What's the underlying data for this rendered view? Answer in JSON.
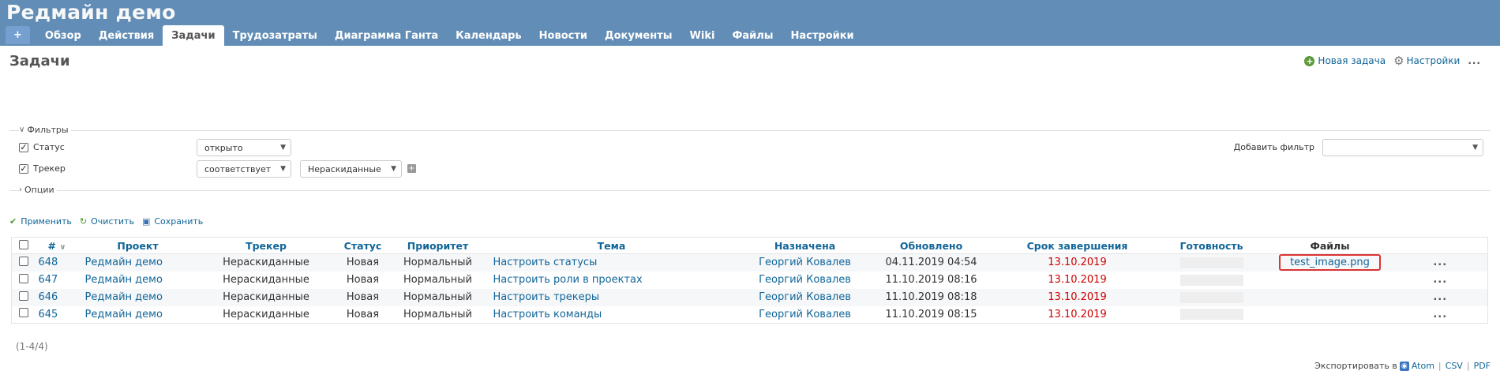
{
  "header": {
    "title": "Редмайн демо",
    "tabs": [
      "+",
      "Обзор",
      "Действия",
      "Задачи",
      "Трудозатраты",
      "Диаграмма Ганта",
      "Календарь",
      "Новости",
      "Документы",
      "Wiki",
      "Файлы",
      "Настройки"
    ],
    "selected_tab": "Задачи"
  },
  "page": {
    "title": "Задачи",
    "new_issue": "Новая задача",
    "settings": "Настройки",
    "more": "..."
  },
  "filters": {
    "legend": "Фильтры",
    "status_label": "Статус",
    "status_value": "открыто",
    "tracker_label": "Трекер",
    "tracker_operator": "соответствует",
    "tracker_value": "Нераскиданные",
    "add_filter_label": "Добавить фильтр",
    "add_filter_value": ""
  },
  "options": {
    "legend": "Опции"
  },
  "actions": {
    "apply": "Применить",
    "clear": "Очистить",
    "save": "Сохранить"
  },
  "table": {
    "columns": [
      "#",
      "Проект",
      "Трекер",
      "Статус",
      "Приоритет",
      "Тема",
      "Назначена",
      "Обновлено",
      "Срок завершения",
      "Готовность",
      "Файлы"
    ],
    "rows": [
      {
        "id": "648",
        "project": "Редмайн демо",
        "tracker": "Нераскиданные",
        "status": "Новая",
        "priority": "Нормальный",
        "subject": "Настроить статусы",
        "assignee": "Георгий Ковалев",
        "updated": "04.11.2019 04:54",
        "due": "13.10.2019",
        "done_pct": 0,
        "files": "test_image.png"
      },
      {
        "id": "647",
        "project": "Редмайн демо",
        "tracker": "Нераскиданные",
        "status": "Новая",
        "priority": "Нормальный",
        "subject": "Настроить роли в проектах",
        "assignee": "Георгий Ковалев",
        "updated": "11.10.2019 08:16",
        "due": "13.10.2019",
        "done_pct": 0,
        "files": ""
      },
      {
        "id": "646",
        "project": "Редмайн демо",
        "tracker": "Нераскиданные",
        "status": "Новая",
        "priority": "Нормальный",
        "subject": "Настроить трекеры",
        "assignee": "Георгий Ковалев",
        "updated": "11.10.2019 08:18",
        "due": "13.10.2019",
        "done_pct": 0,
        "files": ""
      },
      {
        "id": "645",
        "project": "Редмайн демо",
        "tracker": "Нераскиданные",
        "status": "Новая",
        "priority": "Нормальный",
        "subject": "Настроить команды",
        "assignee": "Георгий Ковалев",
        "updated": "11.10.2019 08:15",
        "due": "13.10.2019",
        "done_pct": 0,
        "files": ""
      }
    ]
  },
  "pagination": "(1-4/4)",
  "export": {
    "label": "Экспортировать в",
    "formats": [
      "Atom",
      "CSV",
      "PDF"
    ]
  },
  "colors": {
    "header": "#628db6",
    "link": "#169",
    "due": "#c00",
    "highlight": "#d33"
  }
}
